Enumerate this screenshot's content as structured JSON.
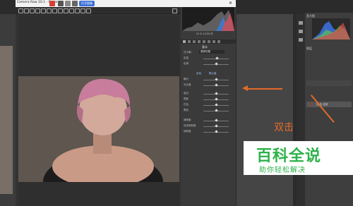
{
  "camera_raw": {
    "title": "Camera Raw 10.1 - Canon",
    "pill_label": "打开图像",
    "panel_title": "基本",
    "histogram_readout": "f/1.8 1/200 秒",
    "white_balance_label": "白平衡：",
    "white_balance_value": "原照设置",
    "sliders": [
      {
        "label": "色温",
        "value": 0.55
      },
      {
        "label": "色调",
        "value": 0.5
      },
      {
        "label": "曝光",
        "value": 0.5
      },
      {
        "label": "对比度",
        "value": 0.5
      },
      {
        "label": "高光",
        "value": 0.5
      },
      {
        "label": "阴影",
        "value": 0.5
      },
      {
        "label": "白色",
        "value": 0.5
      },
      {
        "label": "黑色",
        "value": 0.5
      },
      {
        "label": "清晰度",
        "value": 0.5
      },
      {
        "label": "自然饱和度",
        "value": 0.5
      },
      {
        "label": "饱和度",
        "value": 0.5
      }
    ],
    "auto_label": "自动",
    "default_label": "默认值"
  },
  "photoshop": {
    "panels_title": "直方图",
    "layers_title": "图层",
    "layer_name": "红 色 定制"
  },
  "annotation": {
    "double_click_text": "双击",
    "accent_color": "#e36a2a"
  },
  "watermark": {
    "title": "百科全说",
    "subtitle": "助你轻松解决"
  }
}
